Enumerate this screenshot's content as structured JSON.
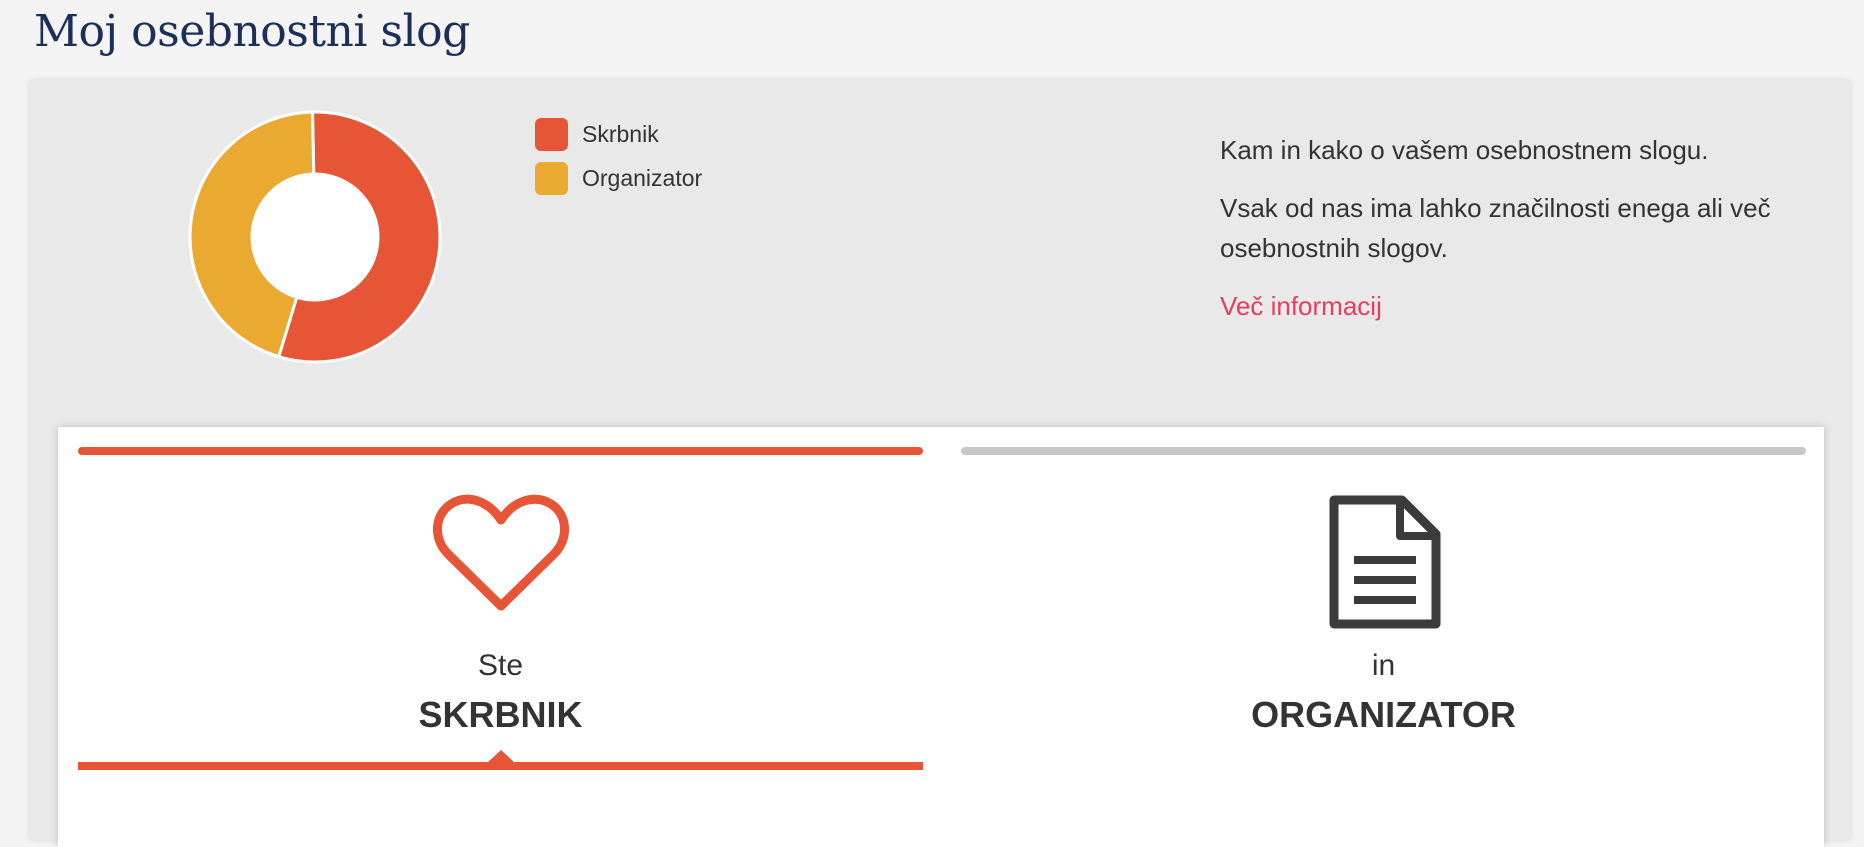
{
  "page_title": "Moj osebnostni slog",
  "legend": [
    {
      "label": "Skrbnik",
      "color": "#e55536"
    },
    {
      "label": "Organizator",
      "color": "#eaaa32"
    }
  ],
  "chart_data": {
    "type": "pie",
    "variant": "donut",
    "categories": [
      "Skrbnik",
      "Organizator"
    ],
    "values": [
      55,
      45
    ],
    "colors": [
      "#e55536",
      "#eaaa32"
    ]
  },
  "info": {
    "intro": "Kam in kako o vašem osebnostnem slogu.",
    "body": "Vsak od nas ima lahko značilnosti enega ali več osebnostnih slogov.",
    "link": "Več informacij",
    "link_color": "#e53e5f"
  },
  "tabs": [
    {
      "prefix": "Ste",
      "name": "SKRBNIK",
      "icon": "heart-icon",
      "color": "#e55536",
      "active": true
    },
    {
      "prefix": "in",
      "name": "ORGANIZATOR",
      "icon": "document-icon",
      "color": "#c8c8c8",
      "active": false
    }
  ]
}
